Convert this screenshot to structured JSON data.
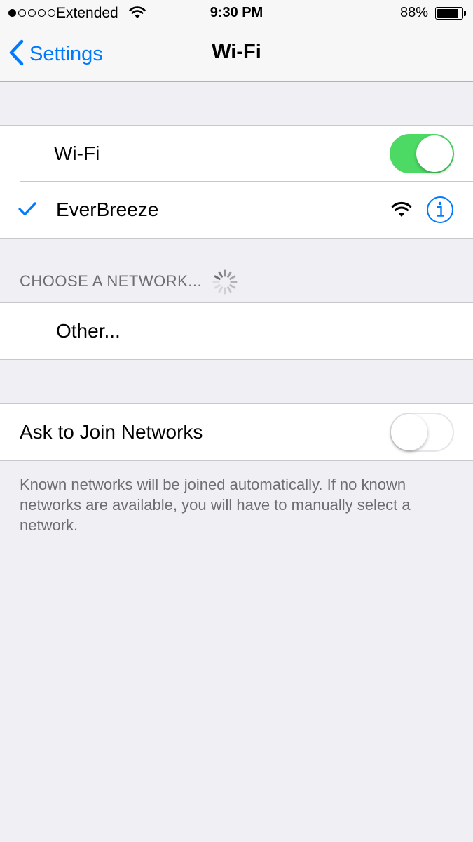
{
  "status_bar": {
    "carrier": "Extended",
    "time": "9:30 PM",
    "battery_percent": "88%",
    "battery_level": 0.88,
    "signal_bars_filled": 1,
    "signal_bars_total": 5
  },
  "nav": {
    "back_label": "Settings",
    "title": "Wi-Fi"
  },
  "wifi_toggle": {
    "label": "Wi-Fi",
    "on": true
  },
  "connected_network": {
    "name": "EverBreeze"
  },
  "choose_network": {
    "header": "CHOOSE A NETWORK...",
    "other_label": "Other..."
  },
  "ask_to_join": {
    "label": "Ask to Join Networks",
    "on": false,
    "footer": "Known networks will be joined automatically. If no known networks are available, you will have to manually select a network."
  },
  "colors": {
    "accent": "#007aff",
    "switch_on": "#4cd964",
    "background": "#efeff4",
    "secondary_text": "#6d6d72"
  },
  "icons": [
    "back-chevron-icon",
    "checkmark-icon",
    "wifi-signal-icon",
    "info-icon",
    "activity-spinner-icon",
    "battery-icon"
  ]
}
